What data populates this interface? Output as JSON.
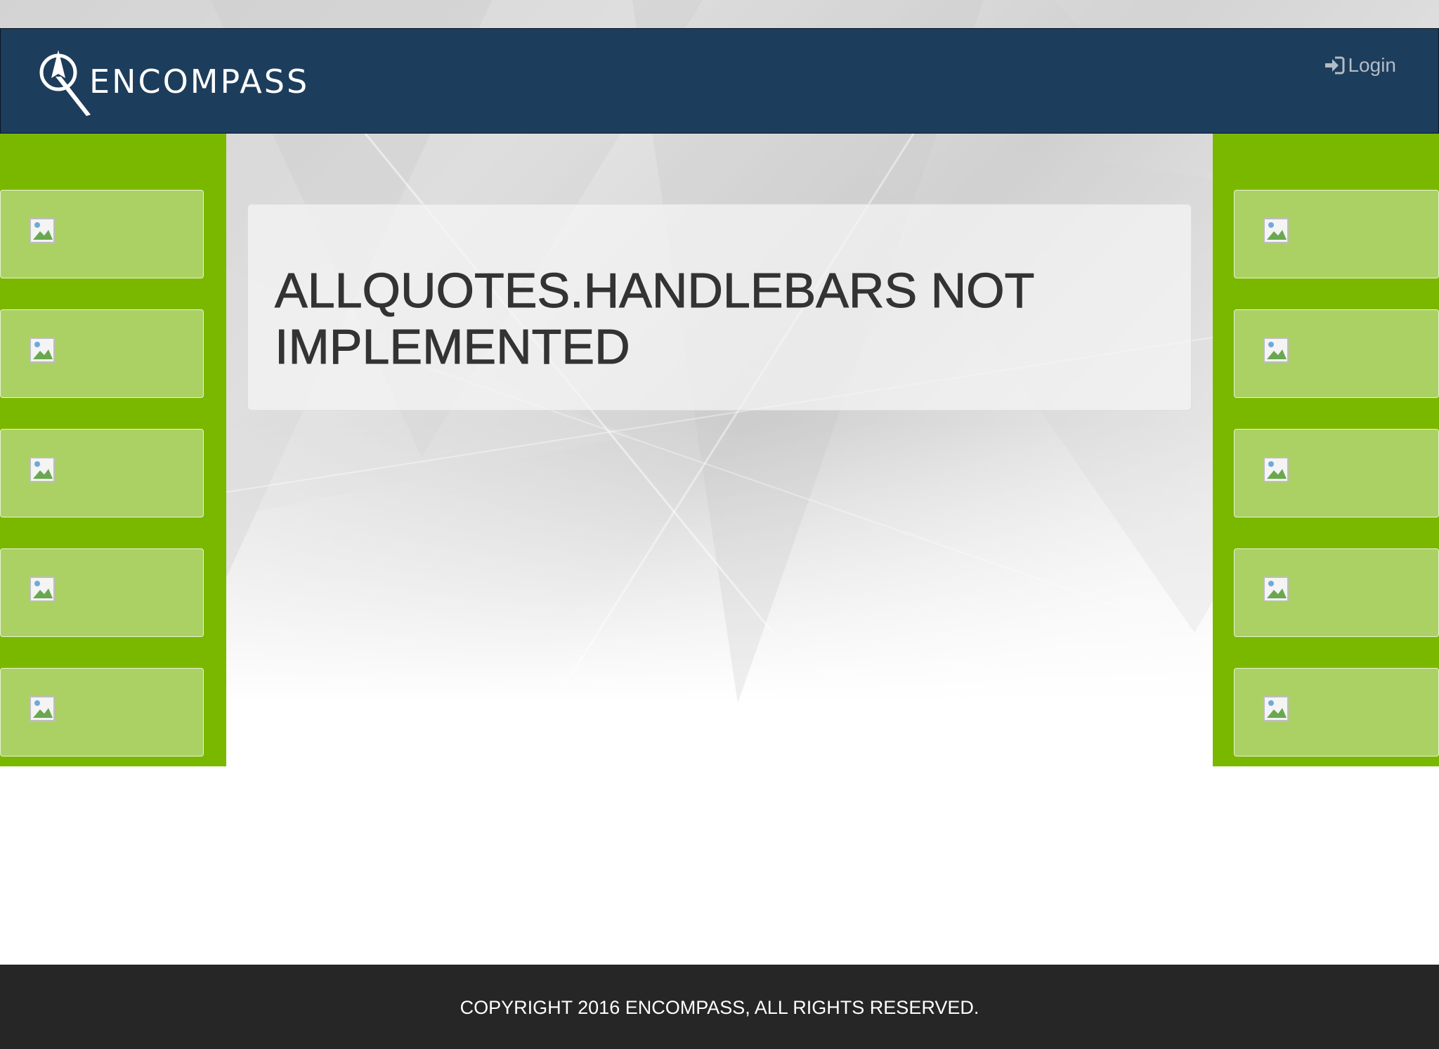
{
  "header": {
    "brand": "ENCOMPASS",
    "login_label": "Login",
    "background_color": "#1d3d5c"
  },
  "sidebars": {
    "left": {
      "color": "#7ab800",
      "tiles": [
        {
          "icon": "broken-image-icon"
        },
        {
          "icon": "broken-image-icon"
        },
        {
          "icon": "broken-image-icon"
        },
        {
          "icon": "broken-image-icon"
        },
        {
          "icon": "broken-image-icon"
        }
      ]
    },
    "right": {
      "color": "#7ab800",
      "tiles": [
        {
          "icon": "broken-image-icon"
        },
        {
          "icon": "broken-image-icon"
        },
        {
          "icon": "broken-image-icon"
        },
        {
          "icon": "broken-image-icon"
        },
        {
          "icon": "broken-image-icon"
        }
      ]
    }
  },
  "main": {
    "message": "ALLQUOTES.HANDLEBARS NOT IMPLEMENTED"
  },
  "footer": {
    "copyright": "COPYRIGHT 2016 ENCOMPASS, ALL RIGHTS RESERVED.",
    "background_color": "#262626"
  }
}
